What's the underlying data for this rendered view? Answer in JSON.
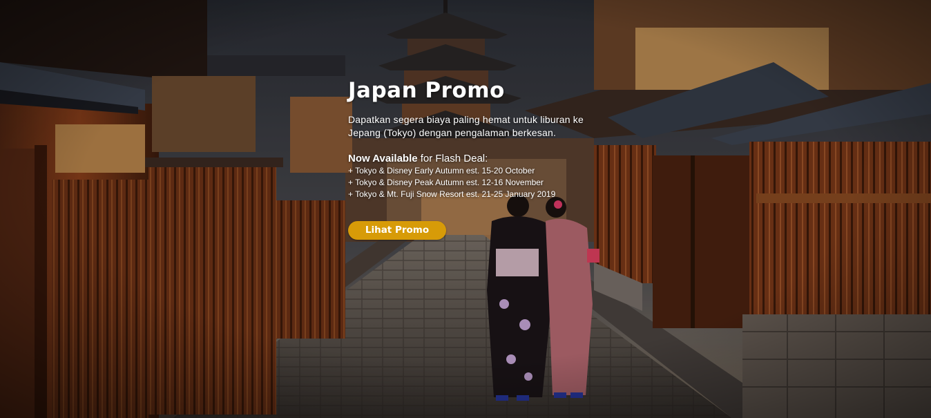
{
  "promo": {
    "title": "Japan Promo",
    "description": "Dapatkan segera biaya paling hemat untuk liburan ke Jepang (Tokyo) dengan pengalaman berkesan.",
    "availability_label": "Now Available",
    "availability_suffix": " for Flash Deal:",
    "deals": [
      "+ Tokyo & Disney Early Autumn est. 15-20 October",
      "+ Tokyo & Disney Peak Autumn est. 12-16 November",
      "+ Tokyo & Mt. Fuji Snow Resort est. 21-25 January 2019"
    ],
    "cta_label": "Lihat Promo"
  },
  "colors": {
    "cta_background": "#d79b08",
    "text": "#ffffff"
  }
}
